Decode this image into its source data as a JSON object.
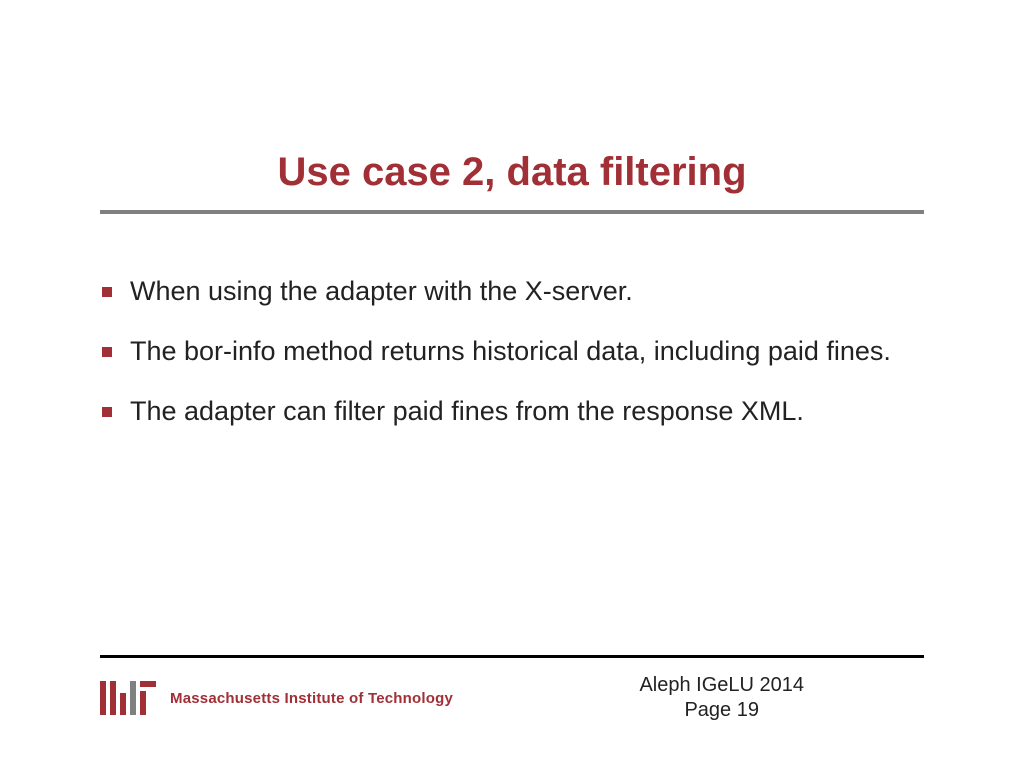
{
  "title": "Use case 2, data filtering",
  "bullets": [
    "When using the adapter with the X-server.",
    "The bor-info method returns historical data, including paid fines.",
    "The adapter can filter paid fines from the response XML."
  ],
  "footer": {
    "institution": "Massachusetts Institute of Technology",
    "event": "Aleph  IGeLU 2014",
    "page": "Page 19"
  },
  "colors": {
    "accent": "#a12f36",
    "rule": "#808080",
    "divider": "#000000"
  }
}
